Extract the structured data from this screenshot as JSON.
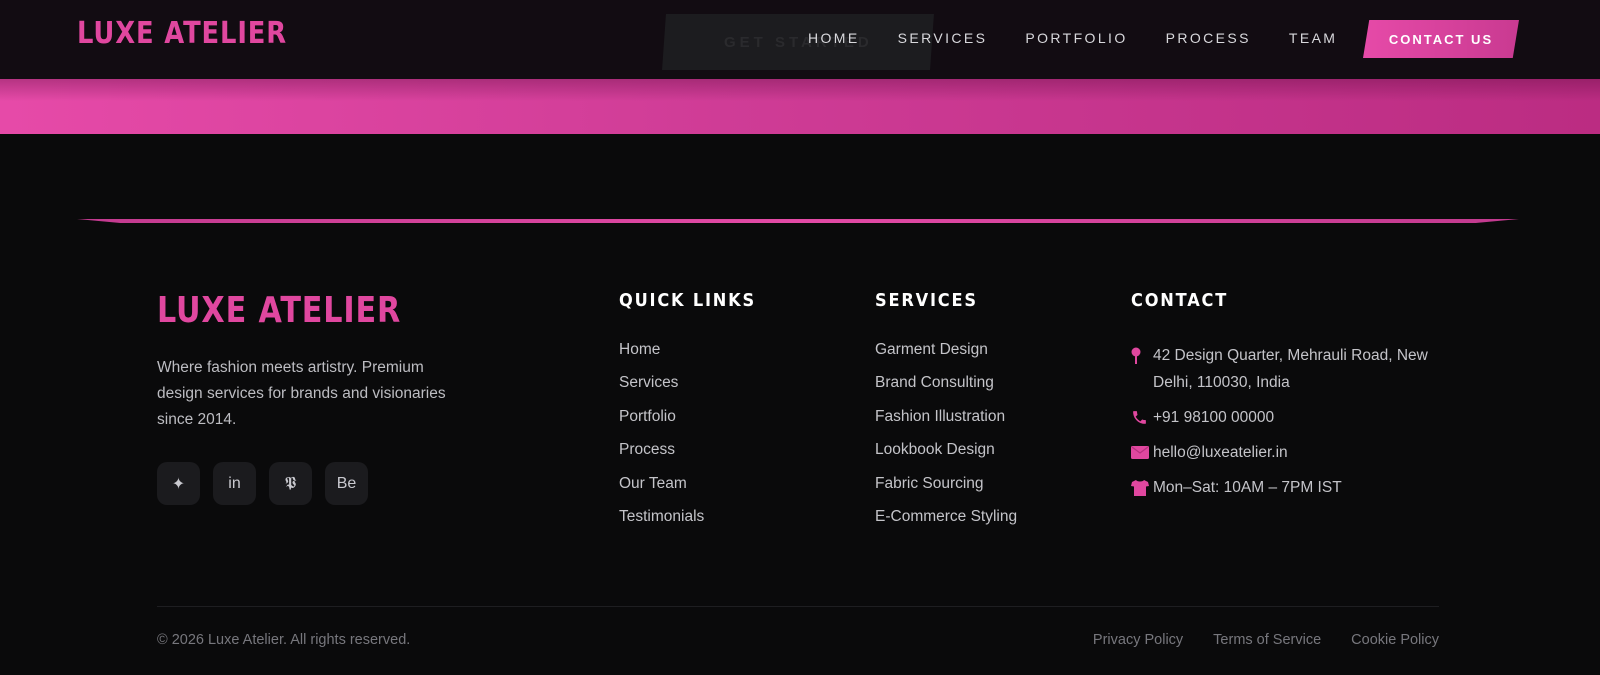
{
  "header": {
    "brand": "LUXE ATELIER",
    "ghost_cta": "GET STARTED",
    "nav": [
      "HOME",
      "SERVICES",
      "PORTFOLIO",
      "PROCESS",
      "TEAM"
    ],
    "contact_label": "CONTACT US"
  },
  "footer": {
    "brand": "LUXE ATELIER",
    "tagline": "Where fashion meets artistry. Premium design services for brands and visionaries since 2014.",
    "socials": [
      {
        "icon": "sparkle-icon",
        "glyph": "✦"
      },
      {
        "icon": "linkedin-icon",
        "glyph": "in"
      },
      {
        "icon": "pinterest-icon",
        "glyph": "𝕻"
      },
      {
        "icon": "behance-icon",
        "glyph": "Be"
      }
    ],
    "quick_links": {
      "title": "QUICK LINKS",
      "items": [
        "Home",
        "Services",
        "Portfolio",
        "Process",
        "Our Team",
        "Testimonials"
      ]
    },
    "services": {
      "title": "SERVICES",
      "items": [
        "Garment Design",
        "Brand Consulting",
        "Fashion Illustration",
        "Lookbook Design",
        "Fabric Sourcing",
        "E-Commerce Styling"
      ]
    },
    "contact": {
      "title": "CONTACT",
      "address": "42 Design Quarter, Mehrauli Road, New Delhi, 110030, India",
      "phone": "+91 98100 00000",
      "email": "hello@luxeatelier.in",
      "hours": "Mon–Sat: 10AM – 7PM IST"
    },
    "copyright": "© 2026 Luxe Atelier. All rights reserved.",
    "legal": [
      "Privacy Policy",
      "Terms of Service",
      "Cookie Policy"
    ]
  },
  "colors": {
    "accent": "#e0479f",
    "background": "#0a0a0b",
    "header": "#120c12"
  }
}
